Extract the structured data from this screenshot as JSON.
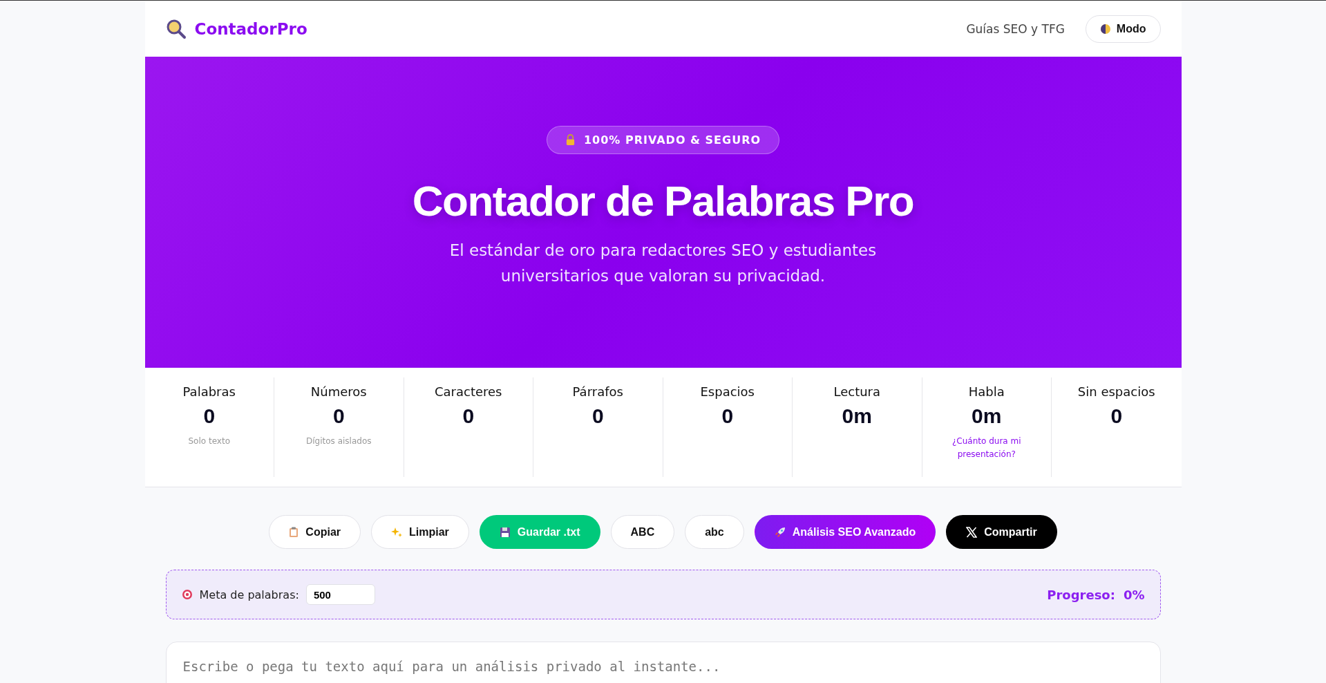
{
  "header": {
    "brand": "ContadorPro",
    "nav_link": "Guías SEO y TFG",
    "mode_button": "Modo"
  },
  "hero": {
    "badge": "100% PRIVADO & SEGURO",
    "title": "Contador de Palabras Pro",
    "subtitle": "El estándar de oro para redactores SEO y estudiantes universitarios que valoran su privacidad."
  },
  "stats": [
    {
      "label": "Palabras",
      "value": "0",
      "note": "Solo texto"
    },
    {
      "label": "Números",
      "value": "0",
      "note": "Dígitos aislados"
    },
    {
      "label": "Caracteres",
      "value": "0"
    },
    {
      "label": "Párrafos",
      "value": "0"
    },
    {
      "label": "Espacios",
      "value": "0"
    },
    {
      "label": "Lectura",
      "value": "0m"
    },
    {
      "label": "Habla",
      "value": "0m",
      "link": "¿Cuánto dura mi presentación?"
    },
    {
      "label": "Sin espacios",
      "value": "0"
    }
  ],
  "actions": [
    {
      "label": "Copiar",
      "kind": "outline"
    },
    {
      "label": "Limpiar",
      "kind": "outline"
    },
    {
      "label": "Guardar .txt",
      "kind": "green"
    },
    {
      "label": "ABC",
      "kind": "outline"
    },
    {
      "label": "abc",
      "kind": "outline"
    },
    {
      "label": "Análisis SEO Avanzado",
      "kind": "gradient"
    },
    {
      "label": "Compartir",
      "kind": "black"
    }
  ],
  "goal": {
    "label": "Meta de palabras:",
    "value": "500",
    "progress_label": "Progreso:",
    "progress_value": "0%"
  },
  "editor": {
    "placeholder": "Escribe o pega tu texto aquí para un análisis privado al instante..."
  }
}
